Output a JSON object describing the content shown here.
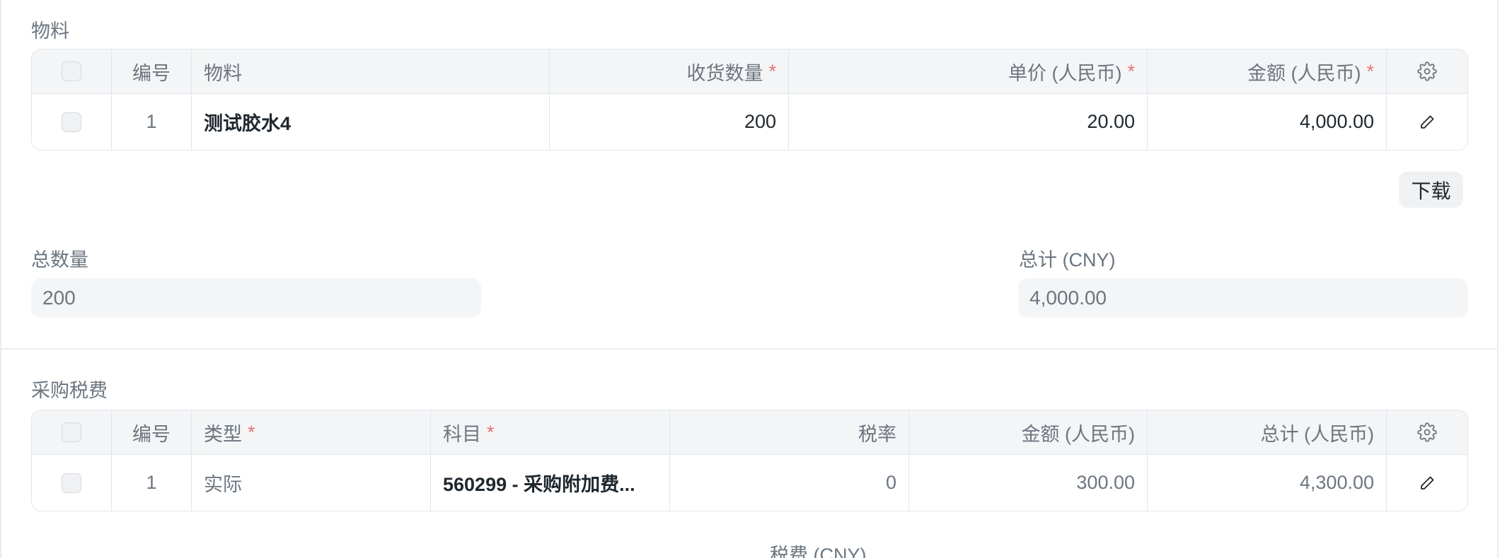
{
  "items_section": {
    "label": "物料",
    "headers": {
      "index": "编号",
      "item": "物料",
      "received_qty": "收货数量",
      "rate": "单价 (人民币)",
      "amount": "金额 (人民币)",
      "required_marker": "*"
    },
    "rows": [
      {
        "index": "1",
        "item": "测试胶水4",
        "received_qty": "200",
        "rate": "20.00",
        "amount": "4,000.00"
      }
    ],
    "download_label": "下载"
  },
  "totals": {
    "total_qty_label": "总数量",
    "total_qty_value": "200",
    "total_label": "总计 (CNY)",
    "total_value": "4,000.00"
  },
  "taxes_section": {
    "label": "采购税费",
    "headers": {
      "index": "编号",
      "type": "类型",
      "account": "科目",
      "rate": "税率",
      "amount": "金额 (人民币)",
      "total": "总计 (人民币)",
      "required_marker": "*"
    },
    "rows": [
      {
        "index": "1",
        "type": "实际",
        "account": "560299 - 采购附加费...",
        "rate": "0",
        "amount": "300.00",
        "total": "4,300.00"
      }
    ]
  },
  "footer": {
    "taxes_label": "税费 (CNY)"
  },
  "icons": {
    "settings": "gear-icon",
    "edit": "pencil-icon",
    "checkbox": "checkbox"
  }
}
